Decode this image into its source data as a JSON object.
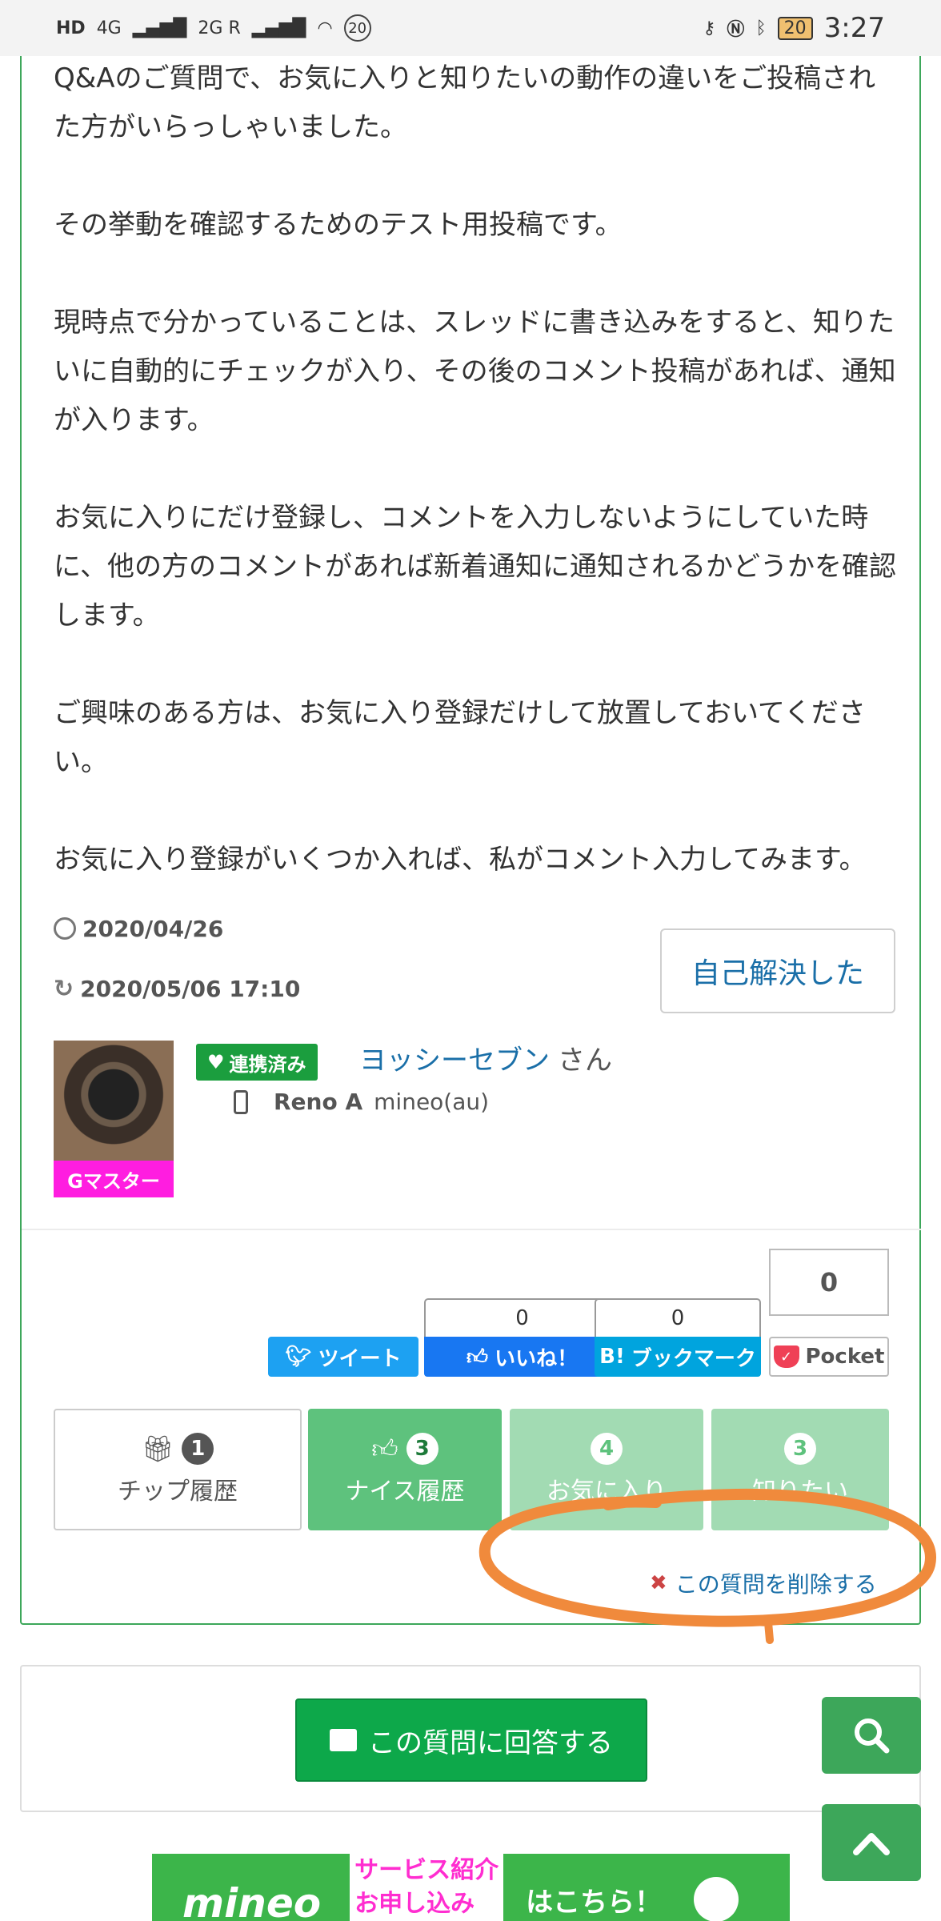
{
  "status_bar": {
    "left_labels": [
      "HD",
      "4G",
      "2G R"
    ],
    "notification_count": "20",
    "battery": "20",
    "time": "3:27"
  },
  "post": {
    "paragraphs": [
      "Q&Aのご質問で、お気に入りと知りたいの動作の違いをご投稿された方がいらっしゃいました。",
      "その挙動を確認するためのテスト用投稿です。",
      "現時点で分かっていることは、スレッドに書き込みをすると、知りたいに自動的にチェックが入り、その後のコメント投稿があれば、通知が入ります。",
      "お気に入りにだけ登録し、コメントを入力しないようにしていた時に、他の方のコメントがあれば新着通知に通知されるかどうかを確認します。",
      "ご興味のある方は、お気に入り登録だけして放置しておいてください。",
      "お気に入り登録がいくつか入れば、私がコメント入力してみます。"
    ],
    "posted_date": "2020/04/26",
    "updated_date": "2020/05/06 17:10",
    "self_solve_label": "自己解決した"
  },
  "author": {
    "badge": "Gマスター",
    "linked_label": "連携済み",
    "name": "ヨッシーセブン",
    "honorific": "さん",
    "device_model": "Reno A",
    "carrier": "mineo(au)"
  },
  "share": {
    "tweet_label": "ツイート",
    "like_label": "いいね！",
    "like_count": "0",
    "bookmark_label": "ブックマーク",
    "bookmark_prefix": "B!",
    "bookmark_count": "0",
    "pocket_label": "Pocket",
    "pocket_count": "0"
  },
  "stats": {
    "chip": {
      "label": "チップ履歴",
      "count": "1"
    },
    "nice": {
      "label": "ナイス履歴",
      "count": "3"
    },
    "favorite": {
      "label": "お気に入り",
      "count": "4"
    },
    "want": {
      "label": "知りたい",
      "count": "3"
    }
  },
  "delete_label": "この質問を削除する",
  "answer_button_label": "この質問に回答する",
  "banner": {
    "brand": "mineo",
    "service_text": "サービス紹介",
    "apply_text": "お申し込み",
    "here_text": "はこちら！"
  },
  "colors": {
    "accent_green": "#3da75a",
    "link_blue": "#1a6fa8",
    "annotation_orange": "#f08a3c"
  }
}
